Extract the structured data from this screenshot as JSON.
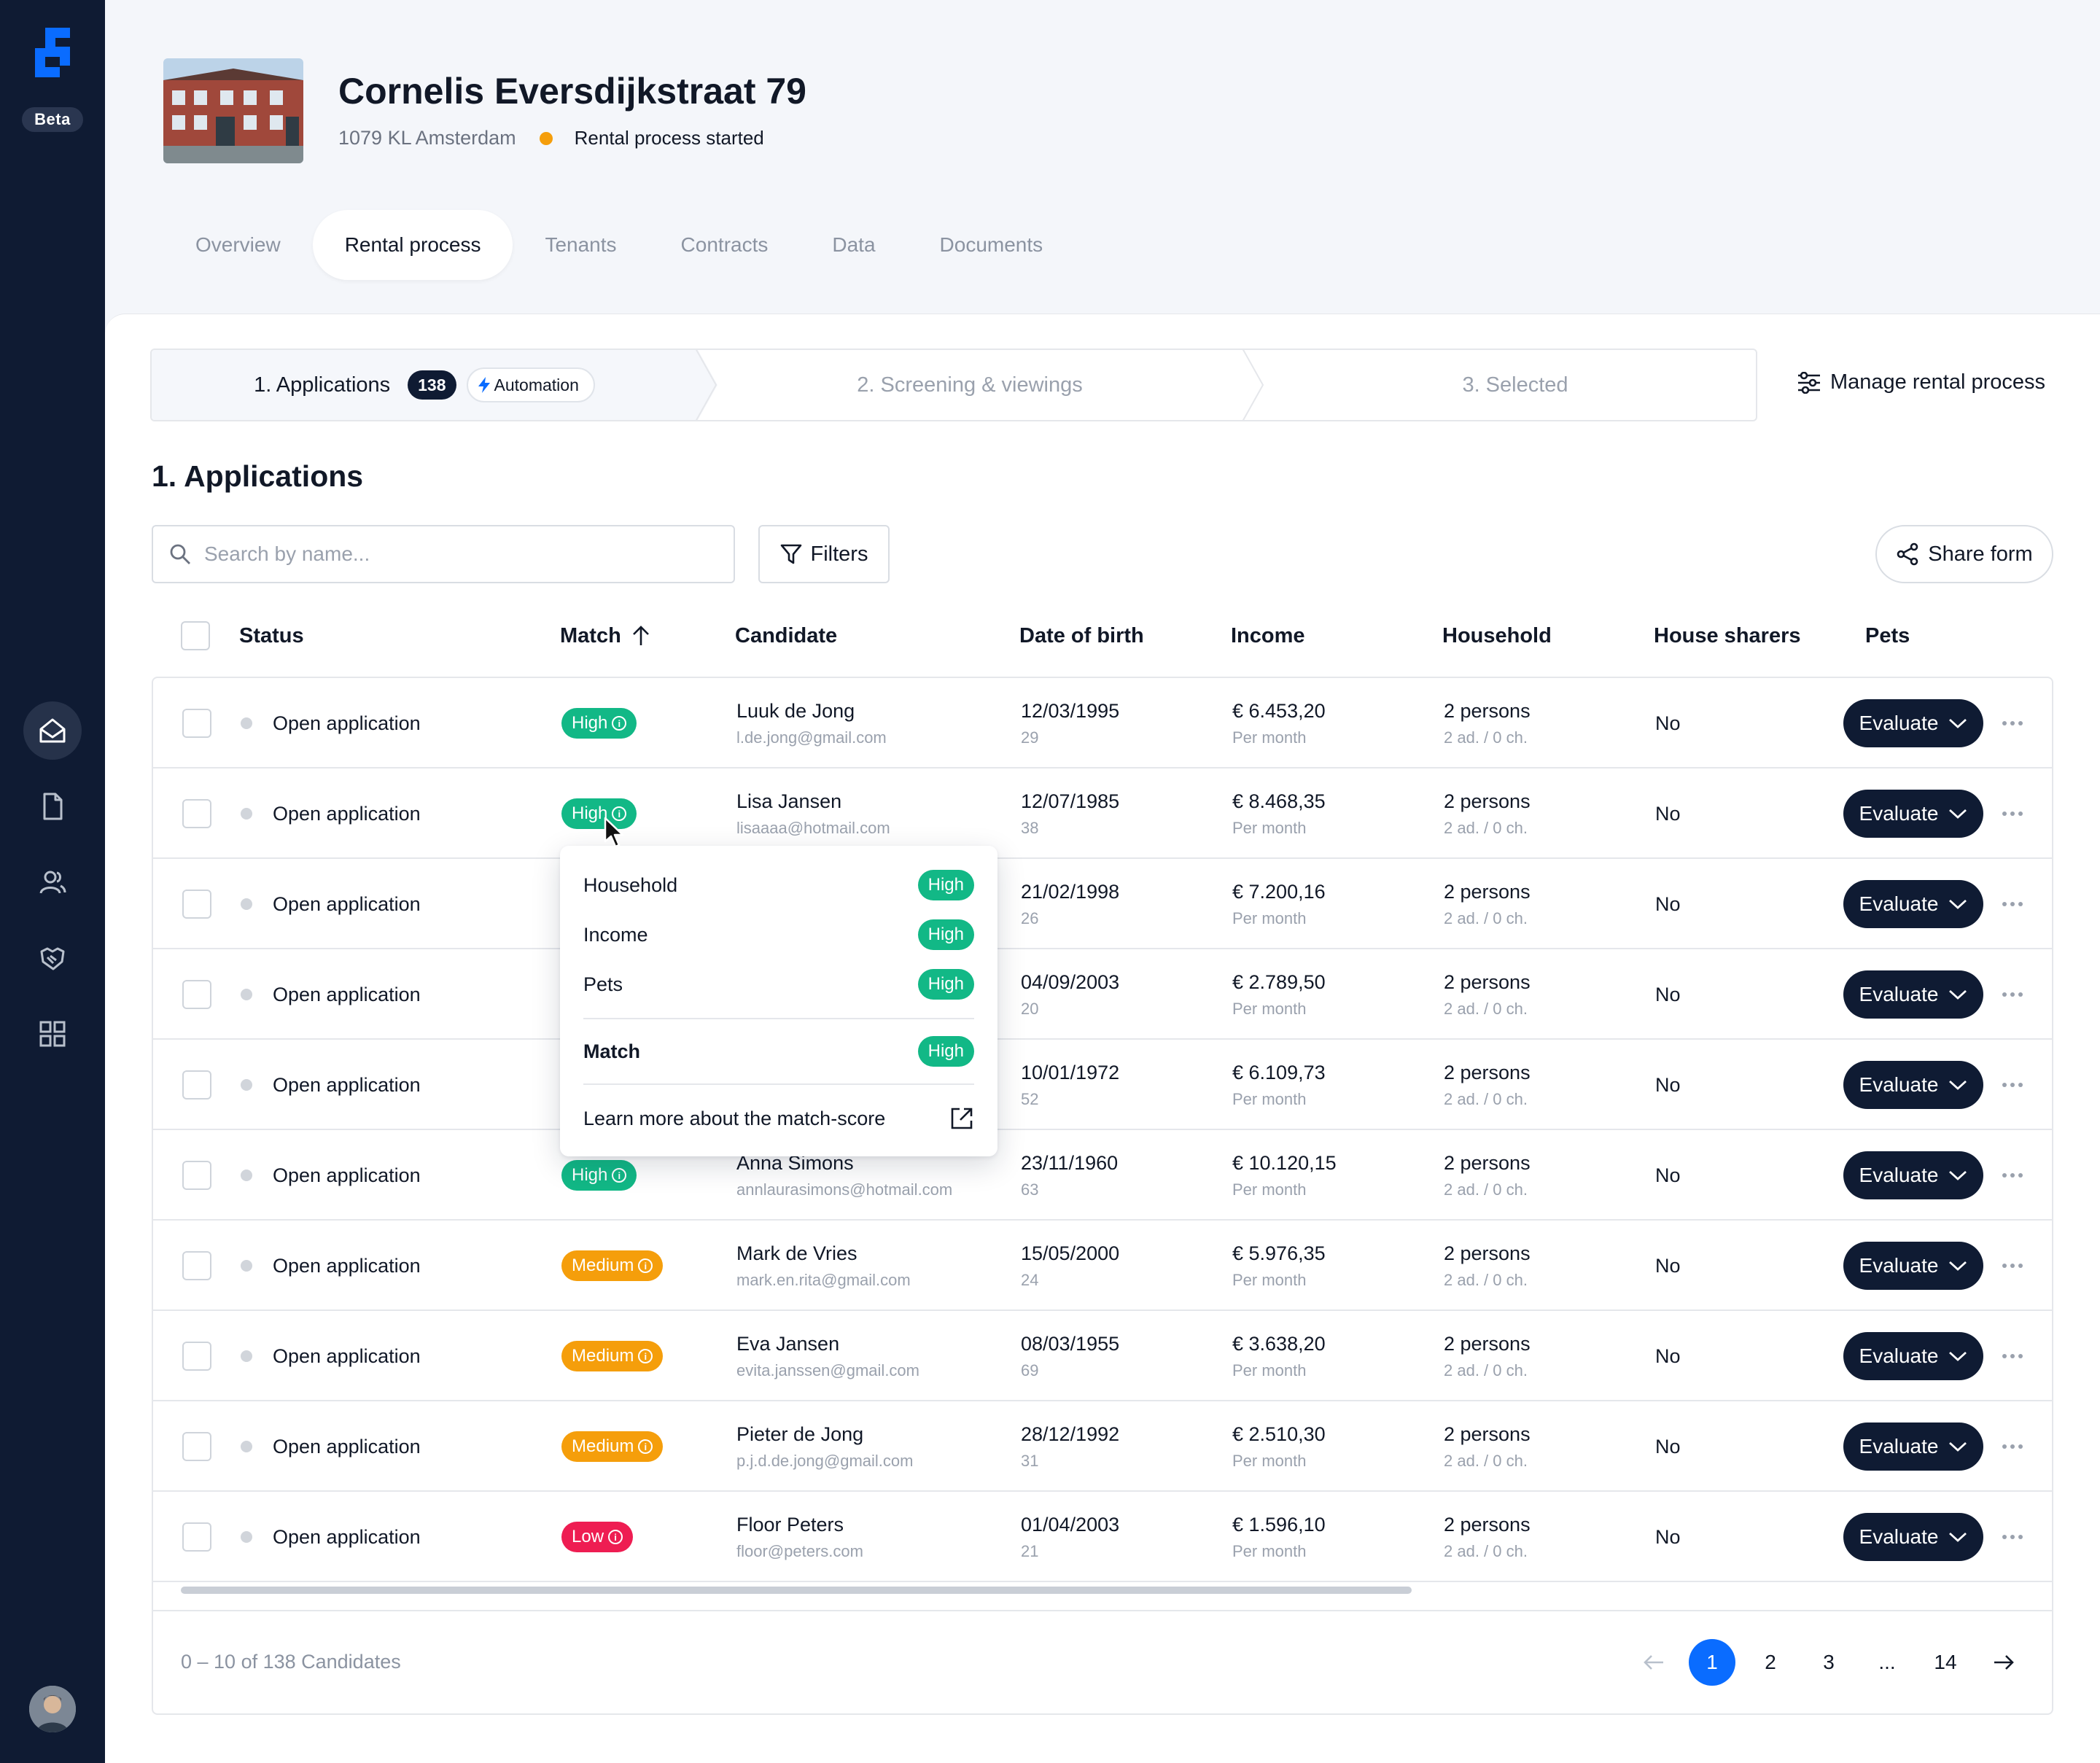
{
  "sidebar": {
    "beta_label": "Beta",
    "nav": [
      {
        "icon": "home-icon",
        "active": true
      },
      {
        "icon": "document-icon",
        "active": false
      },
      {
        "icon": "users-icon",
        "active": false
      },
      {
        "icon": "handshake-icon",
        "active": false
      },
      {
        "icon": "grid-icon",
        "active": false
      }
    ]
  },
  "property": {
    "title": "Cornelis Eversdijkstraat 79",
    "address": "1079 KL Amsterdam",
    "status": "Rental process started",
    "status_color": "#f59e0b"
  },
  "tabs": [
    {
      "label": "Overview",
      "active": false
    },
    {
      "label": "Rental process",
      "active": true
    },
    {
      "label": "Tenants",
      "active": false
    },
    {
      "label": "Contracts",
      "active": false
    },
    {
      "label": "Data",
      "active": false
    },
    {
      "label": "Documents",
      "active": false
    }
  ],
  "stepper": {
    "step1": "1. Applications",
    "step1_count": "138",
    "automation": "Automation",
    "step2": "2. Screening & viewings",
    "step3": "3. Selected",
    "manage": "Manage rental process"
  },
  "section_title": "1. Applications",
  "search": {
    "placeholder": "Search by name..."
  },
  "filters_label": "Filters",
  "share_label": "Share form",
  "columns": {
    "status": "Status",
    "match": "Match",
    "candidate": "Candidate",
    "dob": "Date of birth",
    "income": "Income",
    "household": "Household",
    "house_sharers": "House sharers",
    "pets": "Pets"
  },
  "rows": [
    {
      "status": "Open application",
      "match": "High",
      "match_level": "high",
      "name": "Luuk de Jong",
      "email": "l.de.jong@gmail.com",
      "dob": "12/03/1995",
      "age": "29",
      "income": "€ 6.453,20",
      "income_period": "Per month",
      "household": "2 persons",
      "household_detail": "2 ad. / 0 ch.",
      "sharers": "No",
      "action": "Evaluate"
    },
    {
      "status": "Open application",
      "match": "High",
      "match_level": "high",
      "name": "Lisa Jansen",
      "email": "lisaaaa@hotmail.com",
      "dob": "12/07/1985",
      "age": "38",
      "income": "€ 8.468,35",
      "income_period": "Per month",
      "household": "2 persons",
      "household_detail": "2 ad. / 0 ch.",
      "sharers": "No",
      "action": "Evaluate"
    },
    {
      "status": "Open application",
      "match": "",
      "match_level": "",
      "name": "",
      "email": "",
      "dob": "21/02/1998",
      "age": "26",
      "income": "€ 7.200,16",
      "income_period": "Per month",
      "household": "2 persons",
      "household_detail": "2 ad. / 0 ch.",
      "sharers": "No",
      "action": "Evaluate"
    },
    {
      "status": "Open application",
      "match": "",
      "match_level": "",
      "name": "",
      "email": "",
      "dob": "04/09/2003",
      "age": "20",
      "income": "€ 2.789,50",
      "income_period": "Per month",
      "household": "2 persons",
      "household_detail": "2 ad. / 0 ch.",
      "sharers": "No",
      "action": "Evaluate"
    },
    {
      "status": "Open application",
      "match": "",
      "match_level": "",
      "name": "",
      "email": "",
      "dob": "10/01/1972",
      "age": "52",
      "income": "€ 6.109,73",
      "income_period": "Per month",
      "household": "2 persons",
      "household_detail": "2 ad. / 0 ch.",
      "sharers": "No",
      "action": "Evaluate"
    },
    {
      "status": "Open application",
      "match": "High",
      "match_level": "high",
      "name": "Anna Simons",
      "email": "annlaurasimons@hotmail.com",
      "dob": "23/11/1960",
      "age": "63",
      "income": "€ 10.120,15",
      "income_period": "Per month",
      "household": "2 persons",
      "household_detail": "2 ad. / 0 ch.",
      "sharers": "No",
      "action": "Evaluate"
    },
    {
      "status": "Open application",
      "match": "Medium",
      "match_level": "medium",
      "name": "Mark de Vries",
      "email": "mark.en.rita@gmail.com",
      "dob": "15/05/2000",
      "age": "24",
      "income": "€ 5.976,35",
      "income_period": "Per month",
      "household": "2 persons",
      "household_detail": "2 ad. / 0 ch.",
      "sharers": "No",
      "action": "Evaluate"
    },
    {
      "status": "Open application",
      "match": "Medium",
      "match_level": "medium",
      "name": "Eva Jansen",
      "email": "evita.janssen@gmail.com",
      "dob": "08/03/1955",
      "age": "69",
      "income": "€ 3.638,20",
      "income_period": "Per month",
      "household": "2 persons",
      "household_detail": "2 ad. / 0 ch.",
      "sharers": "No",
      "action": "Evaluate"
    },
    {
      "status": "Open application",
      "match": "Medium",
      "match_level": "medium",
      "name": "Pieter de Jong",
      "email": "p.j.d.de.jong@gmail.com",
      "dob": "28/12/1992",
      "age": "31",
      "income": "€ 2.510,30",
      "income_period": "Per month",
      "household": "2 persons",
      "household_detail": "2 ad. / 0 ch.",
      "sharers": "No",
      "action": "Evaluate"
    },
    {
      "status": "Open application",
      "match": "Low",
      "match_level": "low",
      "name": "Floor Peters",
      "email": "floor@peters.com",
      "dob": "01/04/2003",
      "age": "21",
      "income": "€ 1.596,10",
      "income_period": "Per month",
      "household": "2 persons",
      "household_detail": "2 ad. / 0 ch.",
      "sharers": "No",
      "action": "Evaluate"
    }
  ],
  "popover": {
    "items": [
      {
        "label": "Household",
        "value": "High"
      },
      {
        "label": "Income",
        "value": "High"
      },
      {
        "label": "Pets",
        "value": "High"
      }
    ],
    "match_label": "Match",
    "match_value": "High",
    "learn_more": "Learn more about the match-score"
  },
  "footer": {
    "count_text": "0 – 10  of 138 Candidates",
    "pages": [
      "1",
      "2",
      "3",
      "...",
      "14"
    ],
    "current_page": "1"
  },
  "colors": {
    "sidebar": "#0f1b33",
    "accent_blue": "#0a6cff",
    "high": "#12b886",
    "medium": "#f59e0b",
    "low": "#ee1d52"
  }
}
